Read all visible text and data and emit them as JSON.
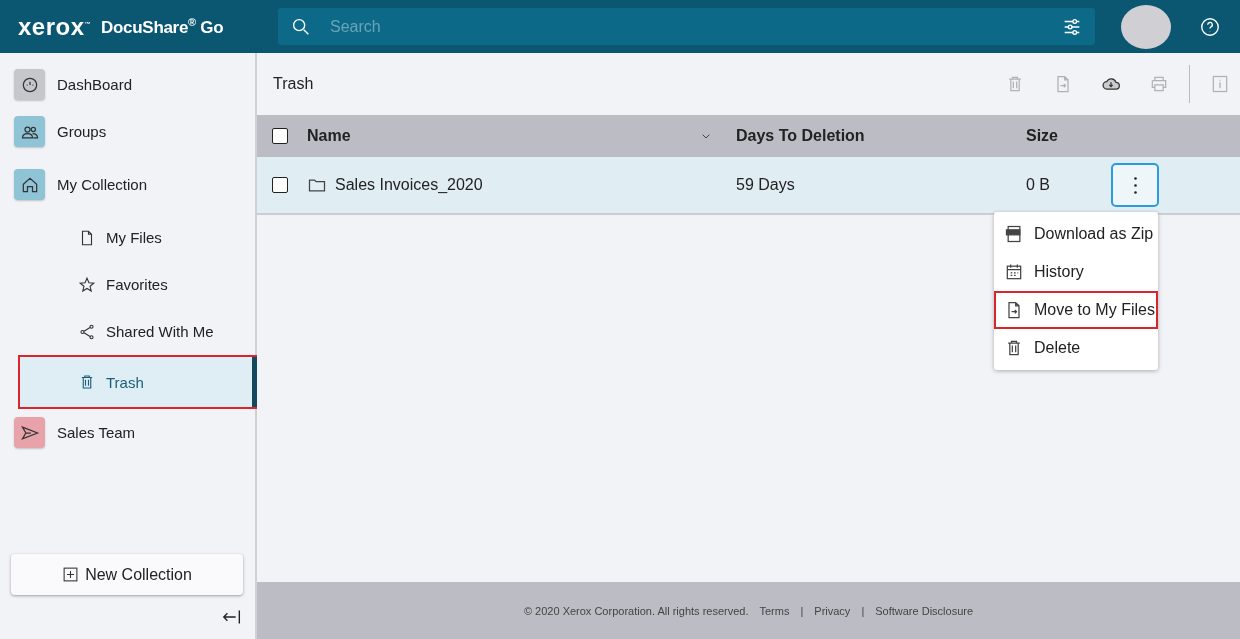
{
  "header": {
    "logo": "xerox$^{™}$",
    "product": "DocuShare$^{®}$ Go",
    "search": {
      "placeholder": "Search"
    }
  },
  "sidebar": {
    "items": [
      {
        "label": "DashBoard",
        "color": "#c6c6cd",
        "selected": false,
        "highlighted": false
      },
      {
        "label": "Groups",
        "color": "#8fc4d7",
        "selected": false,
        "highlighted": false
      },
      {
        "label": "My Collection",
        "color": "#8fc4d7",
        "selected": false,
        "highlighted": false,
        "children": [
          {
            "label": "My Files",
            "selected": false,
            "highlighted": false
          },
          {
            "label": "Favorites",
            "selected": false,
            "highlighted": false
          },
          {
            "label": "Shared With Me",
            "selected": false,
            "highlighted": false
          },
          {
            "label": "Trash",
            "selected": true,
            "highlighted": true
          }
        ]
      },
      {
        "label": "Sales Team",
        "color": "#e8a3aa",
        "selected": false,
        "highlighted": false
      }
    ],
    "new_button": "New Collection"
  },
  "page": {
    "title": "Trash",
    "toolbar": [
      {
        "disabled": true
      },
      {
        "disabled": true
      },
      {
        "disabled": false
      },
      {
        "disabled": true
      },
      {
        "disabled": true
      }
    ]
  },
  "table": {
    "header_checked": false,
    "columns": [
      "Name",
      "Days To Deletion",
      "Size"
    ],
    "rows": [
      {
        "name": "Sales Invoices_2020",
        "days": "59 Days",
        "size": "0 B",
        "checked": false,
        "selected": true
      }
    ]
  },
  "menu": {
    "items": [
      {
        "label": "Download as Zip",
        "highlighted": false
      },
      {
        "label": "History",
        "highlighted": false
      },
      {
        "label": "Move to My Files",
        "highlighted": true
      },
      {
        "label": "Delete",
        "highlighted": false
      }
    ]
  },
  "footer": {
    "copyright": "© 2020 Xerox Corporation. All rights reserved.",
    "links": [
      "Terms",
      "Privacy",
      "Software Disclosure"
    ],
    "separators": [
      "|",
      "|"
    ]
  }
}
